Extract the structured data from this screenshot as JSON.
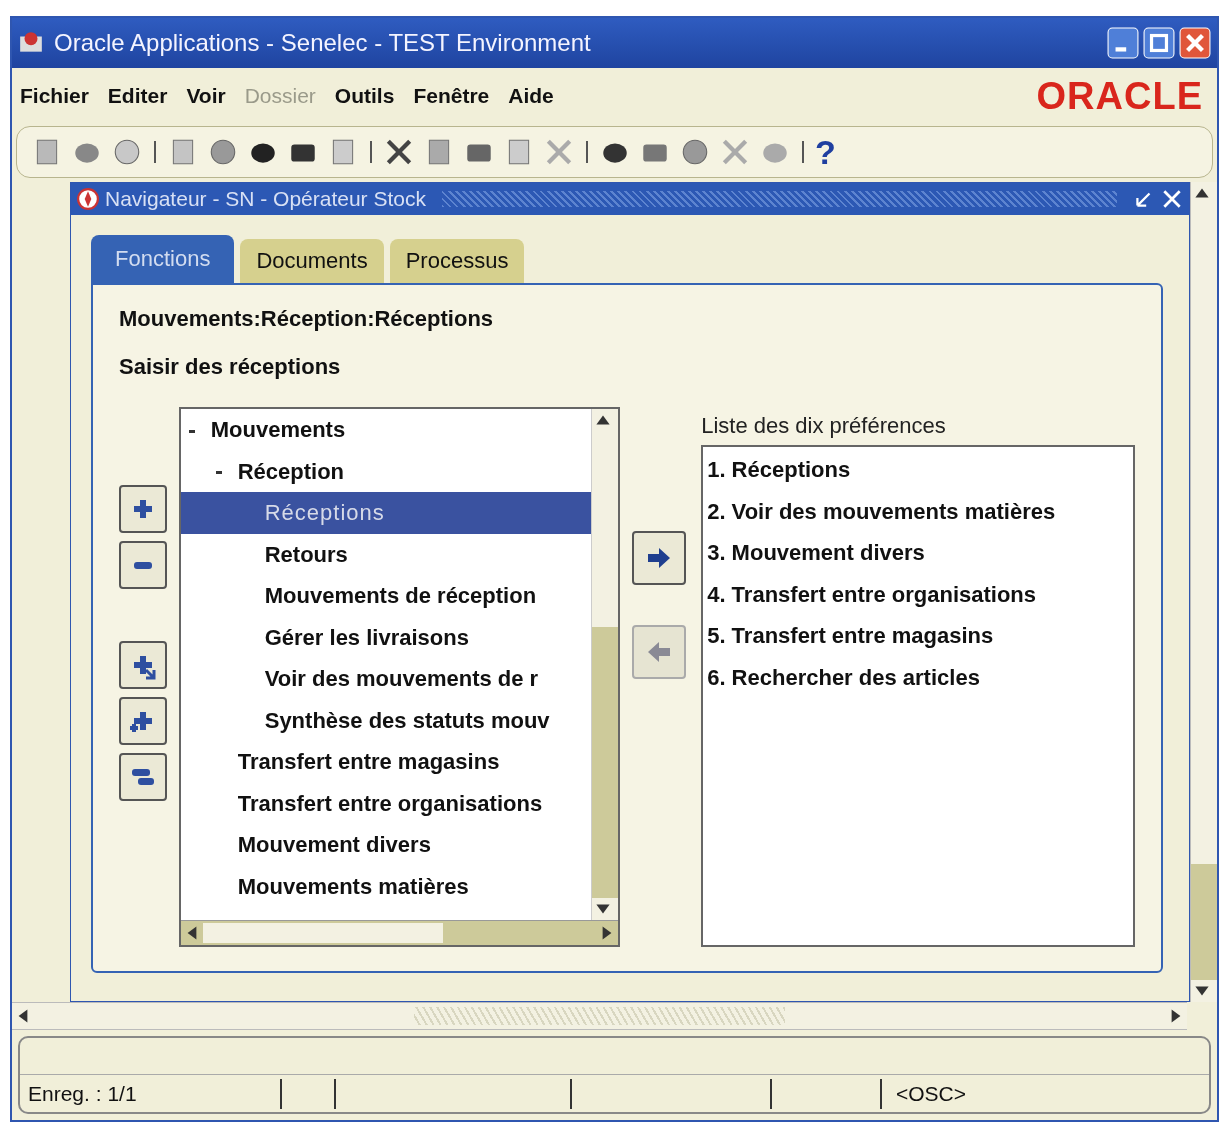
{
  "window": {
    "title": "Oracle Applications - Senelec - TEST Environment"
  },
  "menu": [
    {
      "label": "Fichier",
      "disabled": false
    },
    {
      "label": "Editer",
      "disabled": false
    },
    {
      "label": "Voir",
      "disabled": false
    },
    {
      "label": "Dossier",
      "disabled": true
    },
    {
      "label": "Outils",
      "disabled": false
    },
    {
      "label": "Fenêtre",
      "disabled": false
    },
    {
      "label": "Aide",
      "disabled": false
    }
  ],
  "logo": "ORACLE",
  "toolbar": {
    "help": "?"
  },
  "navigator": {
    "title": "Navigateur - SN - Opérateur Stock",
    "tabs": [
      {
        "label": "Fonctions",
        "selected": true
      },
      {
        "label": "Documents",
        "selected": false
      },
      {
        "label": "Processus",
        "selected": false
      }
    ],
    "path": "Mouvements:Réception:Réceptions",
    "description": "Saisir des réceptions",
    "tree": [
      {
        "label": "Mouvements",
        "expanded": true,
        "selected": false,
        "children": [
          {
            "label": "Réception",
            "expanded": true,
            "selected": false,
            "children": [
              {
                "label": "Réceptions",
                "selected": true
              },
              {
                "label": "Retours",
                "selected": false
              },
              {
                "label": "Mouvements de réception",
                "selected": false
              },
              {
                "label": "Gérer les livraisons",
                "selected": false
              },
              {
                "label": "Voir des mouvements de r",
                "selected": false
              },
              {
                "label": "Synthèse des statuts mouv",
                "selected": false
              }
            ]
          },
          {
            "label": "Transfert entre magasins",
            "selected": false
          },
          {
            "label": "Transfert entre organisations",
            "selected": false
          },
          {
            "label": "Mouvement divers",
            "selected": false
          },
          {
            "label": "Mouvements matières",
            "selected": false
          }
        ]
      }
    ],
    "transfer_buttons": [
      {
        "kind": "add",
        "disabled": false
      },
      {
        "kind": "remove",
        "disabled": true
      }
    ],
    "favorites": {
      "label": "Liste des dix préférences",
      "items": [
        "1. Réceptions",
        "2. Voir des mouvements matières",
        "3. Mouvement divers",
        "4. Transfert entre organisations",
        "5. Transfert entre magasins",
        "6. Rechercher des articles"
      ]
    }
  },
  "status_bar": {
    "record": "Enreg. : 1/1",
    "mode": "<OSC>"
  }
}
